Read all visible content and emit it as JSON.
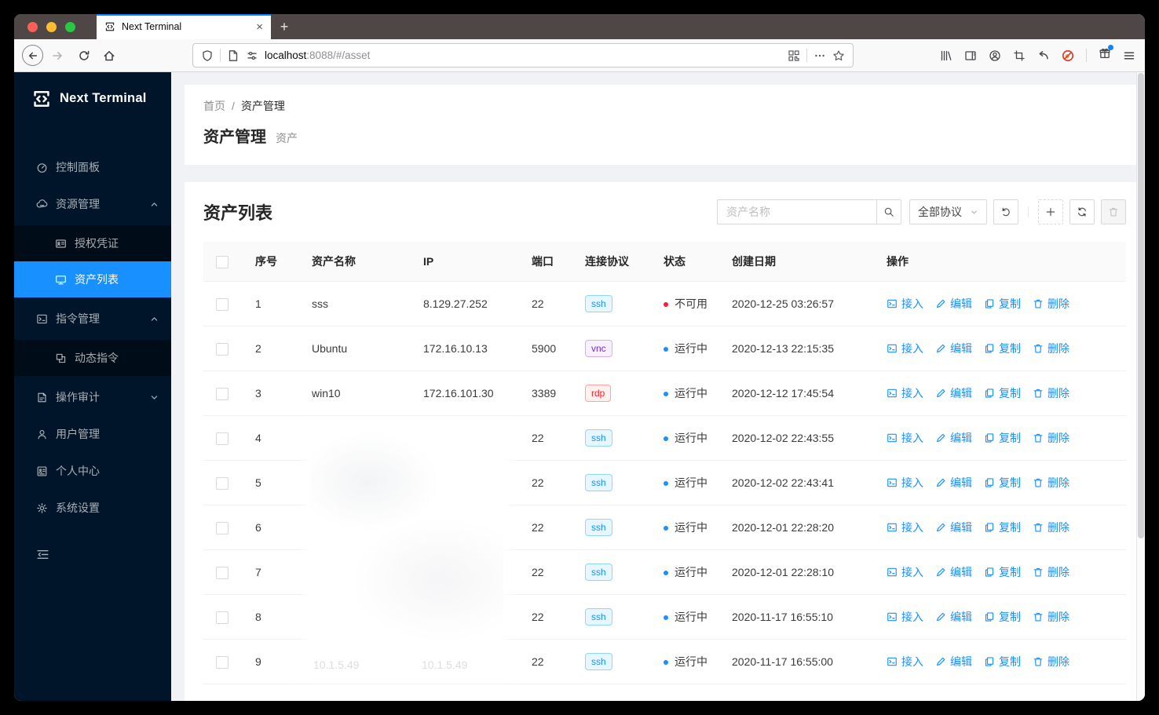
{
  "browser": {
    "tab_title": "Next Terminal",
    "url_host": "localhost",
    "url_rest": ":8088/#/asset",
    "icons": {
      "close": "×",
      "new_tab": "+"
    }
  },
  "sidebar": {
    "logo_text": "Next Terminal",
    "menu": [
      {
        "id": "dashboard",
        "icon": "dashboard-icon",
        "label": "控制面板",
        "kind": "item"
      },
      {
        "id": "resource",
        "icon": "cloud-server-icon",
        "label": "资源管理",
        "kind": "group",
        "caret": "up"
      },
      {
        "id": "credential",
        "icon": "idcard-icon",
        "label": "授权凭证",
        "kind": "sub"
      },
      {
        "id": "asset-list",
        "icon": "desktop-icon",
        "label": "资产列表",
        "kind": "sub",
        "selected": true
      },
      {
        "id": "command-mgmt",
        "icon": "code-icon",
        "label": "指令管理",
        "kind": "group",
        "caret": "up"
      },
      {
        "id": "dynamic-command",
        "icon": "block-icon",
        "label": "动态指令",
        "kind": "sub"
      },
      {
        "id": "audit",
        "icon": "audit-icon",
        "label": "操作审计",
        "kind": "group",
        "caret": "down"
      },
      {
        "id": "user-mgmt",
        "icon": "user-icon",
        "label": "用户管理",
        "kind": "item"
      },
      {
        "id": "profile",
        "icon": "profile-icon",
        "label": "个人中心",
        "kind": "item"
      },
      {
        "id": "settings",
        "icon": "setting-icon",
        "label": "系统设置",
        "kind": "item"
      }
    ]
  },
  "breadcrumb": {
    "home": "首页",
    "separator": "/",
    "current": "资产管理"
  },
  "page_header": {
    "title": "资产管理",
    "subtitle": "资产"
  },
  "panel": {
    "title": "资产列表",
    "search_placeholder": "资产名称",
    "protocol_select": "全部协议"
  },
  "table": {
    "columns": [
      "序号",
      "资产名称",
      "IP",
      "端口",
      "连接协议",
      "状态",
      "创建日期",
      "操作"
    ],
    "action_labels": [
      "接入",
      "编辑",
      "复制",
      "删除"
    ],
    "ghost_text": "10.1.5.49",
    "rows": [
      {
        "no": "1",
        "name": "sss",
        "ip": "8.129.27.252",
        "port": "22",
        "protocol": "ssh",
        "status": "不可用",
        "status_kind": "error",
        "created": "2020-12-25 03:26:57",
        "redacted": false
      },
      {
        "no": "2",
        "name": "Ubuntu",
        "ip": "172.16.10.13",
        "port": "5900",
        "protocol": "vnc",
        "status": "运行中",
        "status_kind": "running",
        "created": "2020-12-13 22:15:35",
        "redacted": false
      },
      {
        "no": "3",
        "name": "win10",
        "ip": "172.16.101.30",
        "port": "3389",
        "protocol": "rdp",
        "status": "运行中",
        "status_kind": "running",
        "created": "2020-12-12 17:45:54",
        "redacted": false
      },
      {
        "no": "4",
        "name": "",
        "ip": "",
        "port": "22",
        "protocol": "ssh",
        "status": "运行中",
        "status_kind": "running",
        "created": "2020-12-02 22:43:55",
        "redacted": true
      },
      {
        "no": "5",
        "name": "",
        "ip": "",
        "port": "22",
        "protocol": "ssh",
        "status": "运行中",
        "status_kind": "running",
        "created": "2020-12-02 22:43:41",
        "redacted": true
      },
      {
        "no": "6",
        "name": "",
        "ip": "",
        "port": "22",
        "protocol": "ssh",
        "status": "运行中",
        "status_kind": "running",
        "created": "2020-12-01 22:28:20",
        "redacted": true
      },
      {
        "no": "7",
        "name": "",
        "ip": "",
        "port": "22",
        "protocol": "ssh",
        "status": "运行中",
        "status_kind": "running",
        "created": "2020-12-01 22:28:10",
        "redacted": true
      },
      {
        "no": "8",
        "name": "",
        "ip": "",
        "port": "22",
        "protocol": "ssh",
        "status": "运行中",
        "status_kind": "running",
        "created": "2020-11-17 16:55:10",
        "redacted": true
      },
      {
        "no": "9",
        "name": "10.1.5.49",
        "ip": "10.1.5.49",
        "port": "22",
        "protocol": "ssh",
        "status": "运行中",
        "status_kind": "running",
        "created": "2020-11-17 16:55:00",
        "redacted": true
      }
    ]
  },
  "colors": {
    "accent": "#1890ff",
    "sidebar_bg": "#001529",
    "submenu_bg": "#000c17",
    "selected_item": "#1890ff",
    "status_error": "#f5222d",
    "status_running": "#1890ff",
    "tag_ssh": "#1890ff",
    "tag_vnc": "#722ed1",
    "tag_rdp": "#f5222d",
    "tab_indicator": "#0a84ff"
  }
}
